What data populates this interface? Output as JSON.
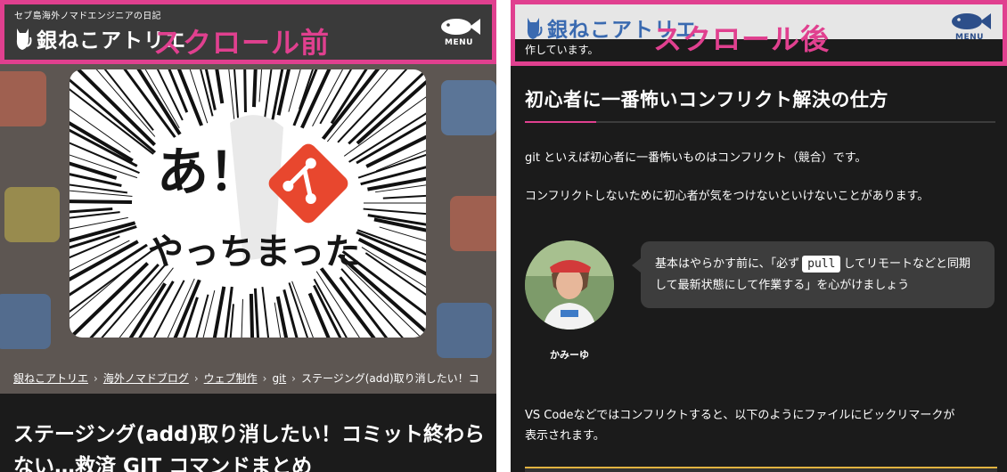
{
  "left": {
    "site_tagline": "セブ島海外ノマドエンジニアの日記",
    "logo_text": "銀ねこアトリエ",
    "scroll_label": "スクロール前",
    "menu_label": "MENU",
    "hero_text_line1": "あ！",
    "hero_text_line2": "やっちまった",
    "breadcrumb": [
      "銀ねこアトリエ",
      "海外ノマドブログ",
      "ウェブ制作",
      "git",
      "ステージング(add)取り消したい！コ"
    ],
    "article_title": "ステージング(add)取り消したい！コミット終わらない…救済 GIT コマンドまとめ"
  },
  "right": {
    "logo_text": "銀ねこアトリエ",
    "scroll_label": "スクロール後",
    "menu_label": "MENU",
    "partial_text": "作しています。",
    "section_title": "初心者に一番怖いコンフリクト解決の仕方",
    "para1": "git といえば初心者に一番怖いものはコンフリクト（競合）です。",
    "para2": "コンフリクトしないために初心者が気をつけないといけないことがあります。",
    "bubble_before": "基本はやらかす前に、「必ず",
    "bubble_code": "pull",
    "bubble_after": "してリモートなどと同期して最新状態にして作業する」を心がけましょう",
    "avatar_name": "かみーゆ",
    "para3": "VS Codeなどではコンフリクトすると、以下のようにファイルにビックリマークが",
    "para4": "表示されます。"
  },
  "colors": {
    "accent_pink": "#e0408f",
    "git_orange": "#e8472e",
    "dark_bg": "#1b1b1b"
  },
  "icons": [
    "cat-logo-icon",
    "fish-menu-icon",
    "git-logo-icon",
    "chevron-right-icon"
  ]
}
